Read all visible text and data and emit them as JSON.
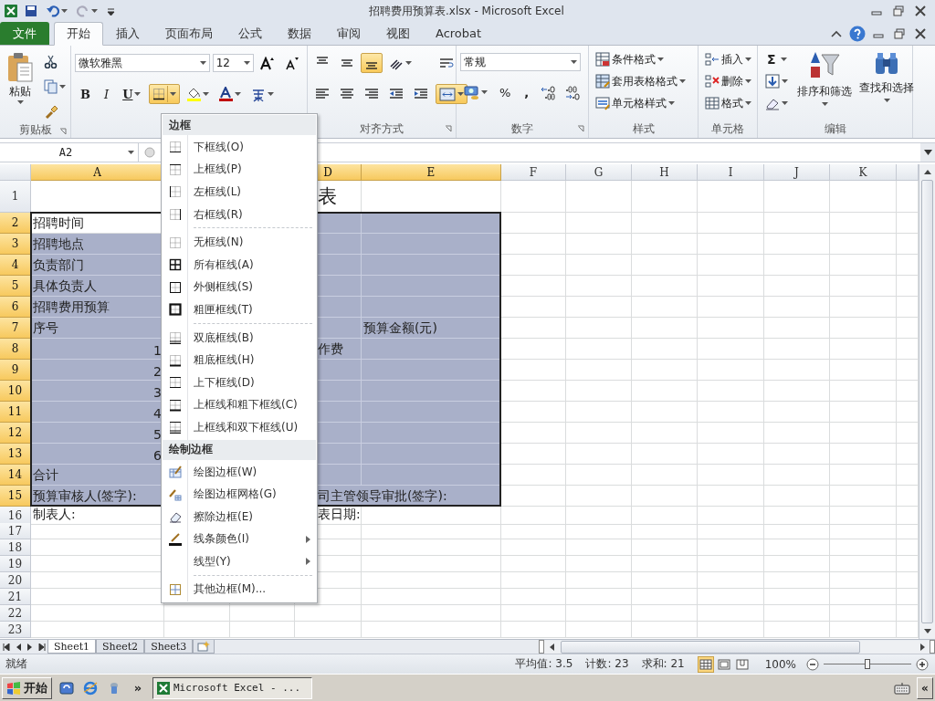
{
  "title_bar": {
    "title": "招聘费用预算表.xlsx - Microsoft Excel"
  },
  "ribbon_tabs": [
    {
      "label": "文件",
      "kind": "file",
      "selected": false
    },
    {
      "label": "开始",
      "kind": "tab",
      "selected": true
    },
    {
      "label": "插入",
      "kind": "tab",
      "selected": false
    },
    {
      "label": "页面布局",
      "kind": "tab",
      "selected": false
    },
    {
      "label": "公式",
      "kind": "tab",
      "selected": false
    },
    {
      "label": "数据",
      "kind": "tab",
      "selected": false
    },
    {
      "label": "审阅",
      "kind": "tab",
      "selected": false
    },
    {
      "label": "视图",
      "kind": "tab",
      "selected": false
    },
    {
      "label": "Acrobat",
      "kind": "tab",
      "selected": false
    }
  ],
  "ribbon": {
    "clipboard": {
      "paste": "粘贴",
      "group_label": "剪贴板"
    },
    "font": {
      "font_name": "微软雅黑",
      "font_size": "12",
      "bold": "B",
      "italic": "I",
      "underline": "U",
      "borders_selected": true
    },
    "alignment": {
      "top_row": [
        {
          "selected": false
        },
        {
          "selected": false
        },
        {
          "selected": true
        },
        {
          "selected": false
        }
      ],
      "bottom_row": [
        {
          "selected": false
        },
        {
          "selected": false
        },
        {
          "selected": false
        },
        {
          "selected": false
        },
        {
          "selected": false
        }
      ],
      "wrap_selected": false,
      "merge_selected": true,
      "group_label": "对齐方式"
    },
    "number": {
      "format": "常规",
      "percent": "%",
      "comma": ",",
      "group_label": "数字"
    },
    "styles": {
      "buttons": [
        "条件格式",
        "套用表格格式",
        "单元格样式"
      ],
      "group_label": "样式"
    },
    "cells": {
      "buttons": [
        "插入",
        "删除",
        "格式"
      ],
      "group_label": "单元格"
    },
    "editing": {
      "sum": "Σ",
      "sort": "排序和筛选",
      "find": "查找和选择",
      "group_label": "编辑"
    }
  },
  "formula_bar": {
    "name_box": "A2"
  },
  "sheet": {
    "columns": {
      "A": {
        "label": "A",
        "selected": true
      },
      "D": {
        "label": "D",
        "selected": true
      },
      "E": {
        "label": "E",
        "selected": true
      },
      "F": {
        "label": "F",
        "selected": false
      },
      "G": {
        "label": "G",
        "selected": false
      },
      "H": {
        "label": "H",
        "selected": false
      },
      "I": {
        "label": "I",
        "selected": false
      },
      "J": {
        "label": "J",
        "selected": false
      },
      "K": {
        "label": "K",
        "selected": false
      }
    },
    "rows": [
      {
        "label": "1",
        "kind": "title",
        "selected": false,
        "cells": {
          "D": {
            "text": "表",
            "kind": "title"
          }
        }
      },
      {
        "label": "2",
        "kind": "table",
        "selected": true,
        "cells": {
          "A": {
            "text": "招聘时间",
            "kind": "text",
            "active": true
          }
        }
      },
      {
        "label": "3",
        "kind": "table",
        "selected": true,
        "cells": {
          "A": {
            "text": "招聘地点",
            "kind": "text"
          }
        }
      },
      {
        "label": "4",
        "kind": "table",
        "selected": true,
        "cells": {
          "A": {
            "text": "负责部门",
            "kind": "text"
          }
        }
      },
      {
        "label": "5",
        "kind": "table",
        "selected": true,
        "cells": {
          "A": {
            "text": "具体负责人",
            "kind": "text"
          }
        }
      },
      {
        "label": "6",
        "kind": "table",
        "selected": true,
        "cells": {
          "A": {
            "text": "招聘费用预算",
            "kind": "text"
          }
        }
      },
      {
        "label": "7",
        "kind": "table",
        "selected": true,
        "cells": {
          "A": {
            "text": "序号",
            "kind": "text"
          },
          "E": {
            "text": "预算金额(元)",
            "kind": "text"
          }
        }
      },
      {
        "label": "8",
        "kind": "table",
        "selected": true,
        "cells": {
          "A": {
            "text": "1",
            "kind": "number"
          },
          "D": {
            "text": "作费",
            "kind": "text"
          }
        }
      },
      {
        "label": "9",
        "kind": "table",
        "selected": true,
        "cells": {
          "A": {
            "text": "2",
            "kind": "number"
          }
        }
      },
      {
        "label": "10",
        "kind": "table",
        "selected": true,
        "cells": {
          "A": {
            "text": "3",
            "kind": "number"
          }
        }
      },
      {
        "label": "11",
        "kind": "table",
        "selected": true,
        "cells": {
          "A": {
            "text": "4",
            "kind": "number"
          }
        }
      },
      {
        "label": "12",
        "kind": "table",
        "selected": true,
        "cells": {
          "A": {
            "text": "5",
            "kind": "number"
          }
        }
      },
      {
        "label": "13",
        "kind": "table",
        "selected": true,
        "cells": {
          "A": {
            "text": "6",
            "kind": "number"
          }
        }
      },
      {
        "label": "14",
        "kind": "table",
        "selected": true,
        "cells": {
          "A": {
            "text": "合计",
            "kind": "text"
          }
        }
      },
      {
        "label": "15",
        "kind": "table",
        "selected": true,
        "cells": {
          "A": {
            "text": "预算审核人(签字):",
            "kind": "text"
          },
          "D": {
            "text": "司主管领导审批(签字):",
            "kind": "text"
          }
        }
      },
      {
        "label": "16",
        "kind": "plain",
        "selected": false,
        "cells": {
          "A": {
            "text": "制表人:",
            "kind": "text"
          },
          "D": {
            "text": "表日期:",
            "kind": "text"
          }
        }
      },
      {
        "label": "17",
        "kind": "plain",
        "selected": false,
        "cells": {}
      },
      {
        "label": "18",
        "kind": "plain",
        "selected": false,
        "cells": {}
      },
      {
        "label": "19",
        "kind": "plain",
        "selected": false,
        "cells": {}
      },
      {
        "label": "20",
        "kind": "plain",
        "selected": false,
        "cells": {}
      },
      {
        "label": "21",
        "kind": "plain",
        "selected": false,
        "cells": {}
      },
      {
        "label": "22",
        "kind": "plain",
        "selected": false,
        "cells": {}
      },
      {
        "label": "23",
        "kind": "plain",
        "selected": false,
        "cells": {}
      }
    ]
  },
  "border_menu": {
    "sections": [
      {
        "title": "边框",
        "groups": [
          [
            {
              "label": "下框线(O)",
              "submenu": false
            },
            {
              "label": "上框线(P)",
              "submenu": false
            },
            {
              "label": "左框线(L)",
              "submenu": false
            },
            {
              "label": "右框线(R)",
              "submenu": false
            }
          ],
          [
            {
              "label": "无框线(N)",
              "submenu": false
            },
            {
              "label": "所有框线(A)",
              "submenu": false
            },
            {
              "label": "外侧框线(S)",
              "submenu": false
            },
            {
              "label": "粗匣框线(T)",
              "submenu": false
            }
          ],
          [
            {
              "label": "双底框线(B)",
              "submenu": false
            },
            {
              "label": "粗底框线(H)",
              "submenu": false
            },
            {
              "label": "上下框线(D)",
              "submenu": false
            },
            {
              "label": "上框线和粗下框线(C)",
              "submenu": false
            },
            {
              "label": "上框线和双下框线(U)",
              "submenu": false
            }
          ]
        ]
      },
      {
        "title": "绘制边框",
        "groups": [
          [
            {
              "label": "绘图边框(W)",
              "submenu": false
            },
            {
              "label": "绘图边框网格(G)",
              "submenu": false
            },
            {
              "label": "擦除边框(E)",
              "submenu": false
            },
            {
              "label": "线条颜色(I)",
              "submenu": true
            },
            {
              "label": "线型(Y)",
              "submenu": true
            }
          ],
          [
            {
              "label": "其他边框(M)...",
              "submenu": false
            }
          ]
        ]
      }
    ]
  },
  "sheet_tabs": [
    {
      "label": "Sheet1",
      "selected": true
    },
    {
      "label": "Sheet2",
      "selected": false
    },
    {
      "label": "Sheet3",
      "selected": false
    }
  ],
  "status_bar": {
    "mode": "就绪",
    "average": "平均值: 3.5",
    "count": "计数: 23",
    "sum": "求和: 21",
    "views": [
      {
        "selected": true
      },
      {
        "selected": false
      },
      {
        "selected": false
      }
    ],
    "zoom": "100%",
    "zoom_slider": {
      "level": 0.5
    }
  },
  "taskbar": {
    "start": "开始",
    "more": "»",
    "task": "Microsoft Excel - ...",
    "tray_toggle": "«"
  }
}
